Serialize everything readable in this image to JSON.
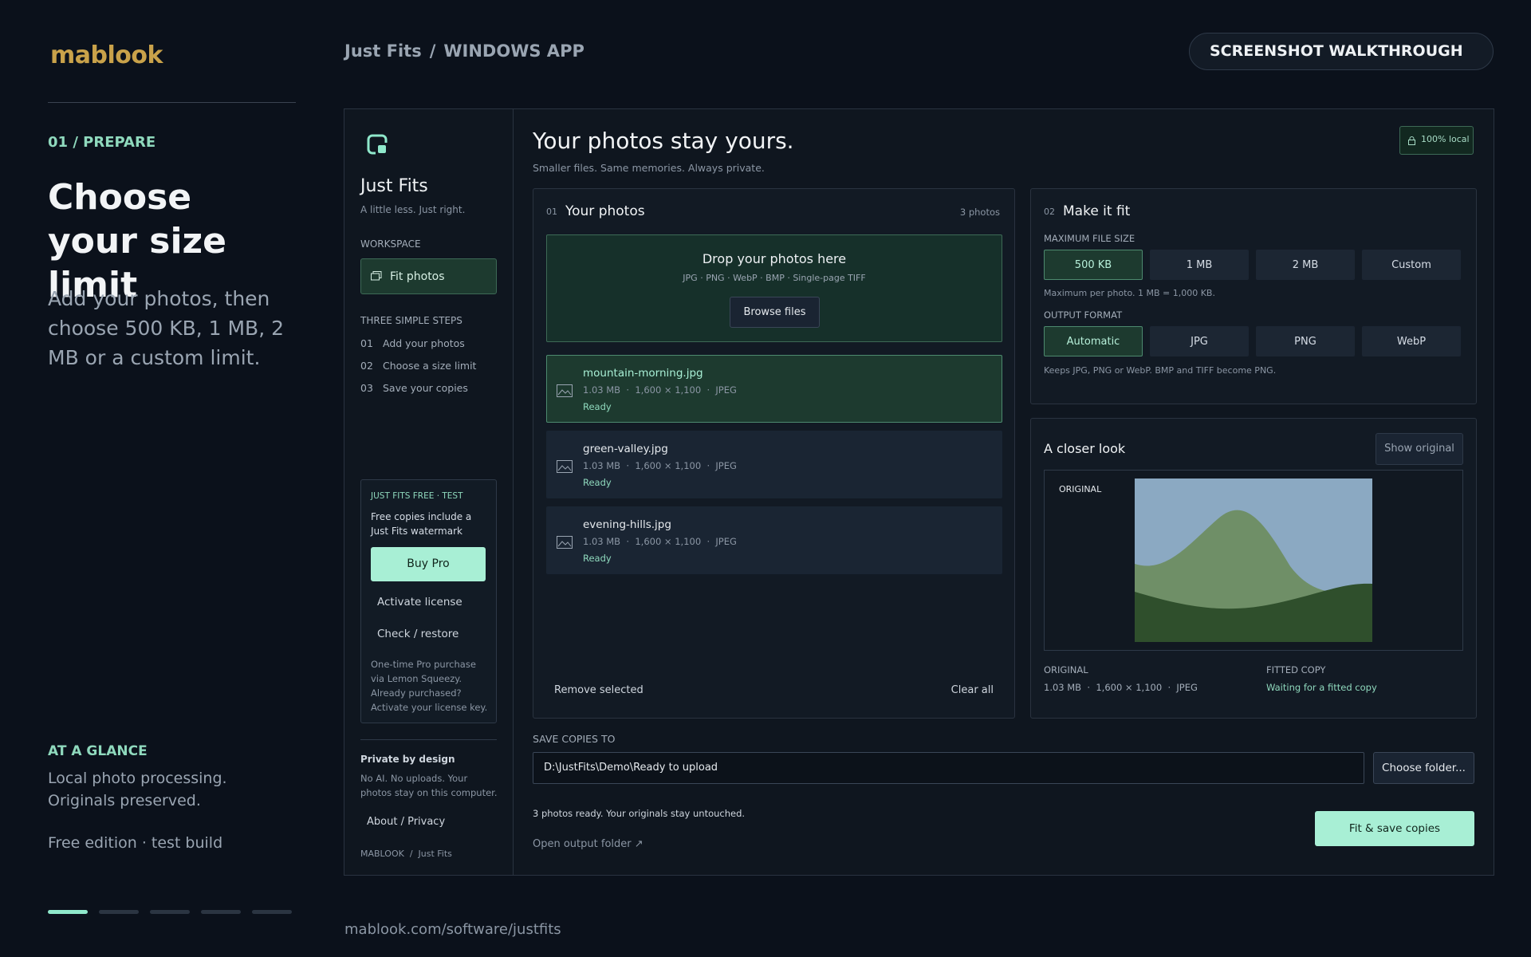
{
  "brand": {
    "logo": "mablook",
    "logo_color": "#c9a24a"
  },
  "slide": {
    "step": "01 / PREPARE",
    "title": "Choose your size limit",
    "description": "Add your photos, then choose 500 KB, 1 MB, 2 MB or a custom limit.",
    "glance_heading": "AT A GLANCE",
    "glance_text": "Local photo processing. Originals preserved.",
    "edition": "Free edition · test build",
    "progress": {
      "current": 1,
      "total": 5
    },
    "url": "mablook.com/software/justfits"
  },
  "header": {
    "crumb_app": "Just Fits",
    "crumb_sep": "/",
    "crumb_page": "WINDOWS APP",
    "walkthrough": "SCREENSHOT WALKTHROUGH"
  },
  "sidebar": {
    "app_name": "Just Fits",
    "tagline": "A little less. Just right.",
    "workspace_label": "WORKSPACE",
    "fit_photos": "Fit photos",
    "steps_label": "THREE SIMPLE STEPS",
    "steps": [
      {
        "num": "01",
        "label": "Add your photos"
      },
      {
        "num": "02",
        "label": "Choose a size limit"
      },
      {
        "num": "03",
        "label": "Save your copies"
      }
    ],
    "license": {
      "heading": "JUST FITS FREE · TEST",
      "text": "Free copies include a Just Fits watermark",
      "buy": "Buy Pro",
      "activate": "Activate license",
      "check": "Check / restore",
      "small": "One-time Pro purchase via Lemon Squeezy. Already purchased? Activate your license key."
    },
    "privacy_heading": "Private by design",
    "privacy_text": "No AI. No uploads. Your photos stay on this computer.",
    "about": "About / Privacy",
    "footer": "MABLOOK  /  Just Fits"
  },
  "main": {
    "title": "Your photos stay yours.",
    "subtitle": "Smaller files. Same memories. Always private.",
    "local_badge": "100% local",
    "photos": {
      "num": "01",
      "title": "Your photos",
      "count": "3 photos",
      "drop_title": "Drop your photos here",
      "drop_formats": "JPG · PNG · WebP · BMP · Single-page TIFF",
      "browse": "Browse files",
      "files": [
        {
          "name": "mountain-morning.jpg",
          "meta": "1.03 MB  ·  1,600 × 1,100  ·  JPEG",
          "status": "Ready",
          "selected": true
        },
        {
          "name": "green-valley.jpg",
          "meta": "1.03 MB  ·  1,600 × 1,100  ·  JPEG",
          "status": "Ready",
          "selected": false
        },
        {
          "name": "evening-hills.jpg",
          "meta": "1.03 MB  ·  1,600 × 1,100  ·  JPEG",
          "status": "Ready",
          "selected": false
        }
      ],
      "remove": "Remove selected",
      "clear": "Clear all"
    },
    "fit": {
      "num": "02",
      "title": "Make it fit",
      "size_label": "MAXIMUM FILE SIZE",
      "sizes": [
        "500 KB",
        "1 MB",
        "2 MB",
        "Custom"
      ],
      "selected_size": "500 KB",
      "size_note": "Maximum per photo. 1 MB = 1,000 KB.",
      "format_label": "OUTPUT FORMAT",
      "formats": [
        "Automatic",
        "JPG",
        "PNG",
        "WebP"
      ],
      "selected_format": "Automatic",
      "format_note": "Keeps JPG, PNG or WebP. BMP and TIFF become PNG."
    },
    "closer": {
      "title": "A closer look",
      "show_original": "Show original",
      "overlay": "ORIGINAL",
      "orig_label": "ORIGINAL",
      "orig_value": "1.03 MB  ·  1,600 × 1,100  ·  JPEG",
      "fitted_label": "FITTED COPY",
      "fitted_value": "Waiting for a fitted copy"
    },
    "save_label": "SAVE COPIES TO",
    "save_path": "D:\\JustFits\\Demo\\Ready to upload",
    "choose_folder": "Choose folder...",
    "ready_text": "3 photos ready. Your originals stay untouched.",
    "open_output": "Open output folder ↗",
    "fit_save": "Fit & save copies"
  },
  "colors": {
    "accent": "#8fd9bd",
    "accent_button": "#a8efd5",
    "selected_bg": "#1d3a2f",
    "background": "#0b111b"
  }
}
